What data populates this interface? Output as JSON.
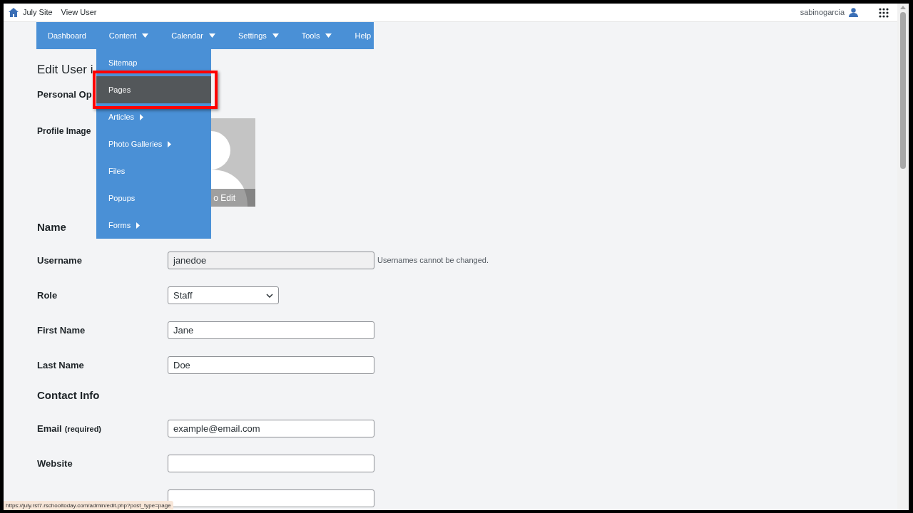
{
  "top_bar": {
    "site": "July Site",
    "link": "View User",
    "user": "sabinogarcia"
  },
  "nav": [
    {
      "label": "Dashboard",
      "has_dropdown": false
    },
    {
      "label": "Content",
      "has_dropdown": true
    },
    {
      "label": "Calendar",
      "has_dropdown": true
    },
    {
      "label": "Settings",
      "has_dropdown": true
    },
    {
      "label": "Tools",
      "has_dropdown": true
    },
    {
      "label": "Help",
      "has_dropdown": false
    }
  ],
  "dropdown": [
    {
      "label": "Sitemap",
      "has_submenu": false,
      "selected": false
    },
    {
      "label": "Pages",
      "has_submenu": false,
      "selected": true
    },
    {
      "label": "Articles",
      "has_submenu": true,
      "selected": false
    },
    {
      "label": "Photo Galleries",
      "has_submenu": true,
      "selected": false
    },
    {
      "label": "Files",
      "has_submenu": false,
      "selected": false
    },
    {
      "label": "Popups",
      "has_submenu": false,
      "selected": false
    },
    {
      "label": "Forms",
      "has_submenu": true,
      "selected": false
    }
  ],
  "page": {
    "heading": "Edit User i",
    "section": "Personal Op",
    "profile_image": {
      "label": "Profile Image",
      "caption": "o Edit"
    }
  },
  "form": [
    {
      "kind": "heading",
      "label": "Name"
    },
    {
      "kind": "text",
      "label": "Username",
      "value": "janedoe",
      "disabled": true,
      "note": "Usernames cannot be changed."
    },
    {
      "kind": "select",
      "label": "Role",
      "value": "Staff"
    },
    {
      "kind": "text",
      "label": "First Name",
      "value": "Jane",
      "disabled": false
    },
    {
      "kind": "text",
      "label": "Last Name",
      "value": "Doe",
      "disabled": false
    },
    {
      "kind": "heading",
      "label": "Contact Info"
    },
    {
      "kind": "text",
      "label": "Email",
      "hint": "(required)",
      "value": "example@email.com",
      "disabled": false
    },
    {
      "kind": "text",
      "label": "Website",
      "disabled": false
    },
    {
      "kind": "text",
      "disabled": false
    }
  ],
  "status_url": "https://july.rst7.rschooltoday.com/admin/edit.php?post_type=page"
}
